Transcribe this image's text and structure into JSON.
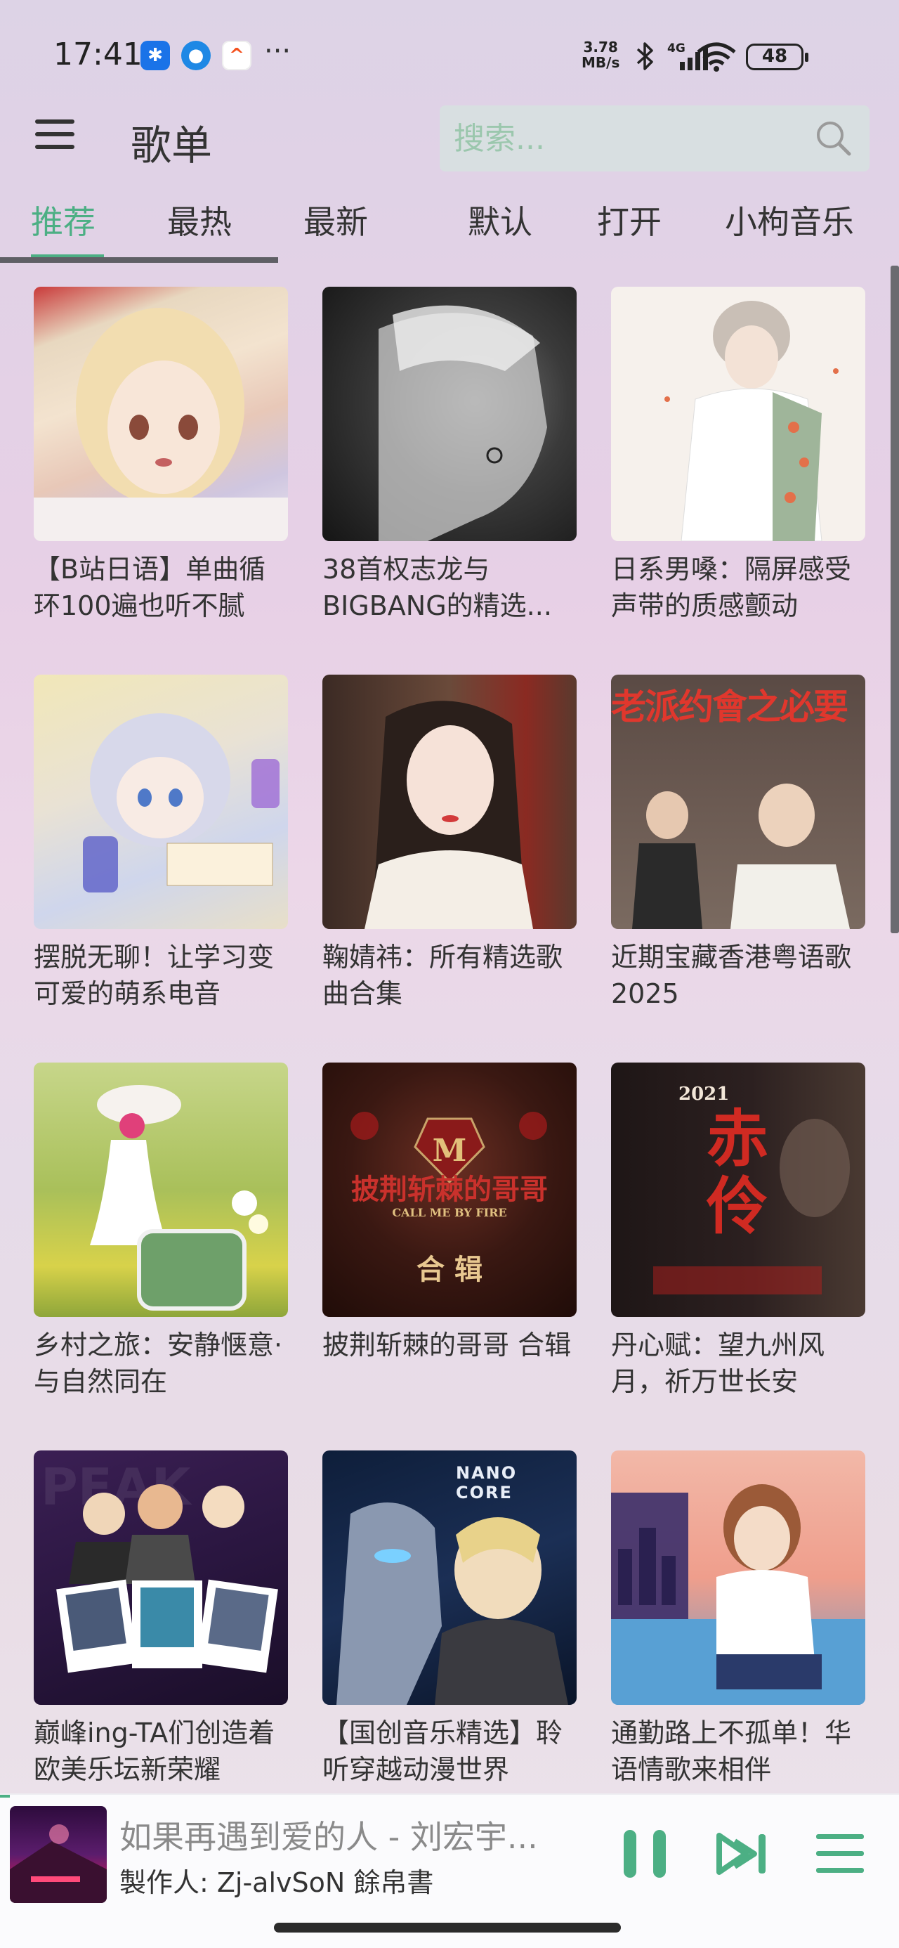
{
  "status_bar": {
    "time": "17:41",
    "network_speed_value": "3.78",
    "network_speed_unit": "MB/s",
    "network_type": "4G",
    "battery": "48",
    "more_indicator": "···"
  },
  "header": {
    "title": "歌单",
    "search_placeholder": "搜索..."
  },
  "tabs": [
    {
      "label": "推荐",
      "active": true
    },
    {
      "label": "最热",
      "active": false
    },
    {
      "label": "最新",
      "active": false
    },
    {
      "label": "默认",
      "active": false
    },
    {
      "label": "打开",
      "active": false
    },
    {
      "label": "小枸音乐",
      "active": false
    }
  ],
  "playlists": [
    {
      "title": "【B站日语】单曲循环100遍也听不腻"
    },
    {
      "title": "38首权志龙与BIGBANG的精选..."
    },
    {
      "title": "日系男嗓：隔屏感受声带的质感颤动"
    },
    {
      "title": "摆脱无聊！让学习变可爱的萌系电音"
    },
    {
      "title": "鞠婧祎：所有精选歌曲合集"
    },
    {
      "title": "近期宝藏香港粤语歌2025"
    },
    {
      "title": "乡村之旅：安静惬意·与自然同在"
    },
    {
      "title": "披荆斩棘的哥哥 合辑"
    },
    {
      "title": "丹心赋：望九州风月，祈万世长安"
    },
    {
      "title": "巅峰ing-TA们创造着欧美乐坛新荣耀"
    },
    {
      "title": "【国创音乐精选】聆听穿越动漫世界"
    },
    {
      "title": "通勤路上不孤单！华语情歌来相伴"
    }
  ],
  "cover_text": {
    "c6_banner": "老派约會之必要",
    "c8_title": "披荆斩棘的哥哥",
    "c8_sub": "CALL ME BY FIRE",
    "c8_label": "合 辑",
    "c9_year": "2021",
    "c9_title": "赤伶",
    "c10_bg": "PEAK",
    "c11_logo": "NANO CORE"
  },
  "player": {
    "song": "如果再遇到爱的人 - 刘宏宇...",
    "artist": "製作人: Zj-alvSoN 餘帛書"
  },
  "colors": {
    "accent": "#4caf84",
    "tab_track": "#5f5f65"
  }
}
